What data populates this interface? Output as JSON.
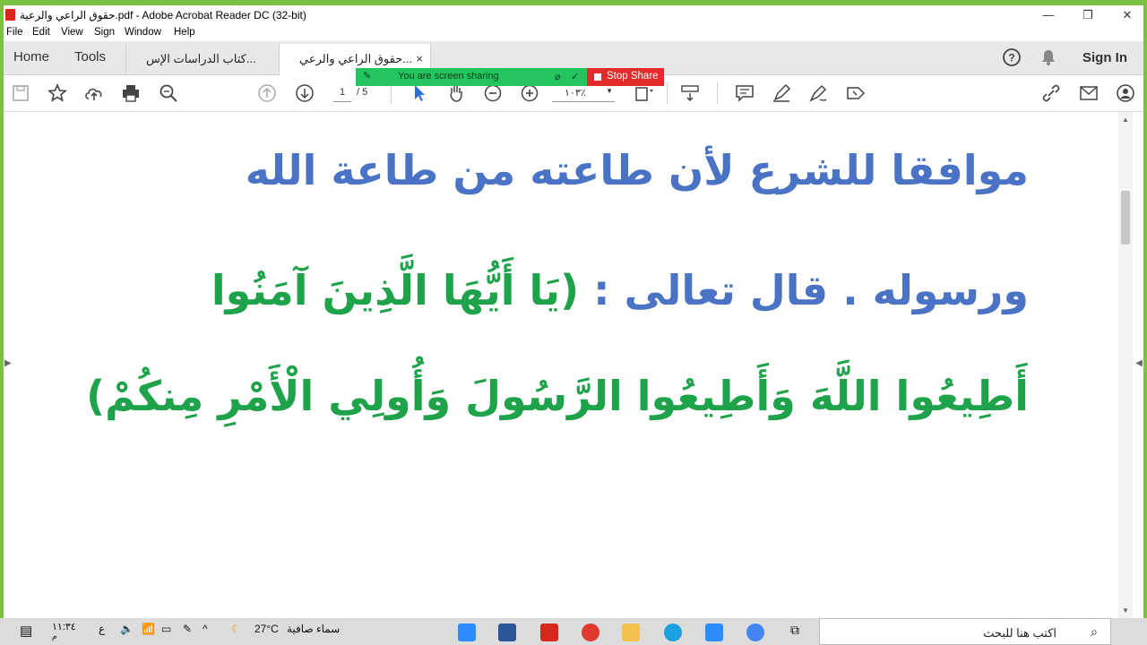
{
  "window": {
    "title": "حقوق الراعي والرعية.pdf - Adobe Acrobat Reader DC (32-bit)"
  },
  "menu": [
    "File",
    "Edit",
    "View",
    "Sign",
    "Window",
    "Help"
  ],
  "tabs": {
    "home": "Home",
    "tools": "Tools",
    "doc_inactive": "كتاب الدراسات الإس...",
    "doc_active": "حقوق الراعي والرعي...",
    "close": "×",
    "sign_in": "Sign In"
  },
  "toolbar": {
    "page_current": "1",
    "page_total": "/ 5",
    "zoom": "١٠٣٪"
  },
  "screen_share": {
    "status": "You are screen sharing",
    "stop": "Stop Share"
  },
  "document": {
    "line1": "موافقا للشرع لأن طاعته من طاعة الله",
    "line2_blue": "ورسوله . قال تعالى : ",
    "line2_green": "(يَا أَيُّهَا الَّذِينَ آمَنُوا",
    "line3": "أَطِيعُوا اللَّهَ وَأَطِيعُوا الرَّسُولَ وَأُولِي الْأَمْرِ مِنكُمْ)",
    "colors": {
      "blue": "#4a73c5",
      "green": "#1ea34a"
    }
  },
  "taskbar": {
    "time": "١١:٣٤",
    "ampm": "م",
    "lang": "ع",
    "temperature": "27°C",
    "weather": "سماء صافية",
    "search_placeholder": "اكتب هنا للبحث"
  }
}
